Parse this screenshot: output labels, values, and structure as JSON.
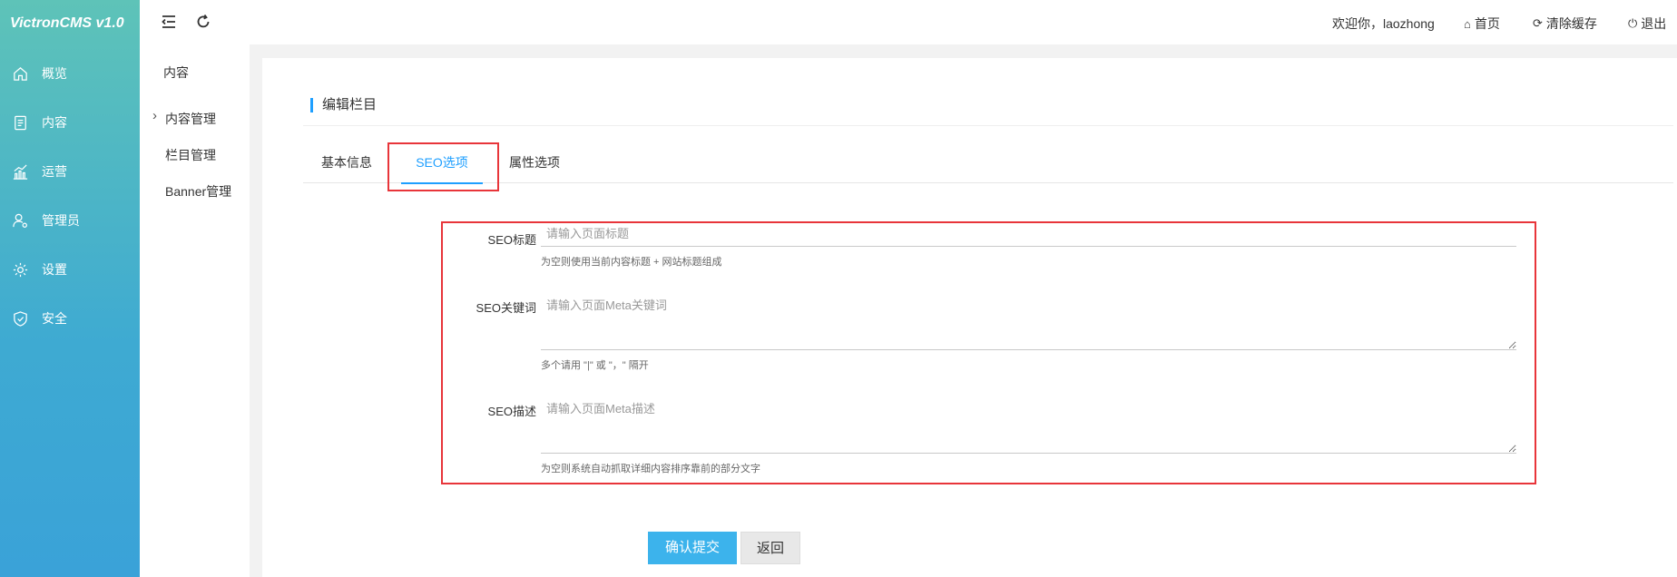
{
  "app": {
    "logo": "VictronCMS v1.0"
  },
  "sidebar": {
    "items": [
      {
        "label": "概览",
        "icon": "home-icon"
      },
      {
        "label": "内容",
        "icon": "document-icon"
      },
      {
        "label": "运营",
        "icon": "chart-icon"
      },
      {
        "label": "管理员",
        "icon": "user-gear-icon"
      },
      {
        "label": "设置",
        "icon": "gear-icon"
      },
      {
        "label": "安全",
        "icon": "shield-icon"
      }
    ]
  },
  "subnav": {
    "title": "内容",
    "items": [
      {
        "label": "内容管理"
      },
      {
        "label": "栏目管理"
      },
      {
        "label": "Banner管理"
      }
    ]
  },
  "topbar": {
    "welcome": "欢迎你，laozhong",
    "home": "首页",
    "clear_cache": "清除缓存",
    "logout": "退出"
  },
  "main": {
    "section_title": "编辑栏目",
    "tabs": [
      {
        "label": "基本信息"
      },
      {
        "label": "SEO选项"
      },
      {
        "label": "属性选项"
      }
    ],
    "form": {
      "seo_title": {
        "label": "SEO标题",
        "placeholder": "请输入页面标题",
        "value": "",
        "help": "为空则使用当前内容标题 + 网站标题组成"
      },
      "seo_keywords": {
        "label": "SEO关键词",
        "placeholder": "请输入页面Meta关键词",
        "value": "",
        "help": "多个请用 \"|\" 或 \"，\" 隔开"
      },
      "seo_description": {
        "label": "SEO描述",
        "placeholder": "请输入页面Meta描述",
        "value": "",
        "help": "为空则系统自动抓取详细内容排序靠前的部分文字"
      }
    },
    "buttons": {
      "submit": "确认提交",
      "back": "返回"
    }
  },
  "colors": {
    "accent": "#1e9fff",
    "primary_button": "#3cb3ec",
    "highlight": "#e8353a"
  }
}
